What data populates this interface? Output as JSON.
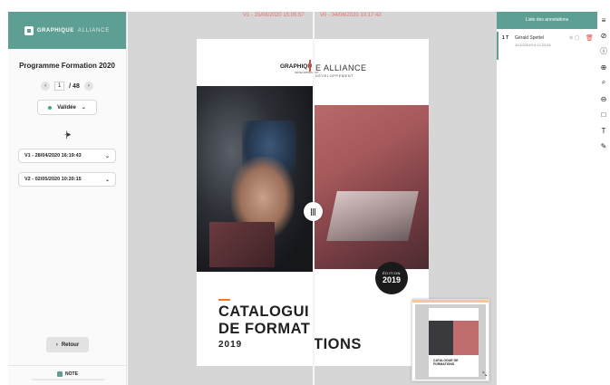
{
  "brand": {
    "name": "GRAPHIQUE",
    "suffix": "ALLIANCE"
  },
  "sidebar": {
    "title": "Programme Formation 2020",
    "pager": {
      "current": "1",
      "total": "/ 48"
    },
    "status": {
      "label": "Validée"
    },
    "versions": [
      {
        "label": "V1 - 28/04/2020 16:19:43"
      },
      {
        "label": "V2 - 02/05/2020 10:20:15"
      }
    ],
    "back_label": "Retour",
    "footer_logo": "NOTE"
  },
  "canvas": {
    "left_version": "V1 - 15/08/2020 15:05:57",
    "right_version": "V0 - 04/06/2020 10:17:42",
    "doc": {
      "logo_left": "GRAPHIQU",
      "logo_left_sub": "DÉVELOPPEMENT",
      "logo_right": "E ALLIANCE",
      "logo_right_sub": "DÉVELOPPEMENT",
      "badge_top": "ÉDITION",
      "badge_year": "2019",
      "title_line1": "CATALOGUI",
      "title_line2": "DE FORMAT",
      "title_line2_right": "TIONS",
      "year": "2019"
    },
    "minimap": {
      "text": "CATALOGUE DE FORMATIONS"
    }
  },
  "annotations": {
    "header": "Liste des annotations",
    "items": [
      {
        "num": "1 T",
        "author": "Gérald Spettel",
        "date": "11/10/2019 à 12:22:54",
        "actions": "⊘ ◯"
      }
    ]
  },
  "colors": {
    "accent": "#5e9f93",
    "danger": "#e14a4a",
    "orange": "#f07c2a",
    "version_text": "#e86e6e"
  },
  "tools": [
    "menu-icon",
    "eye-off-icon",
    "info-icon",
    "zoom-in-icon",
    "search-icon",
    "zoom-out-icon",
    "square-icon",
    "text-icon",
    "pen-icon"
  ]
}
